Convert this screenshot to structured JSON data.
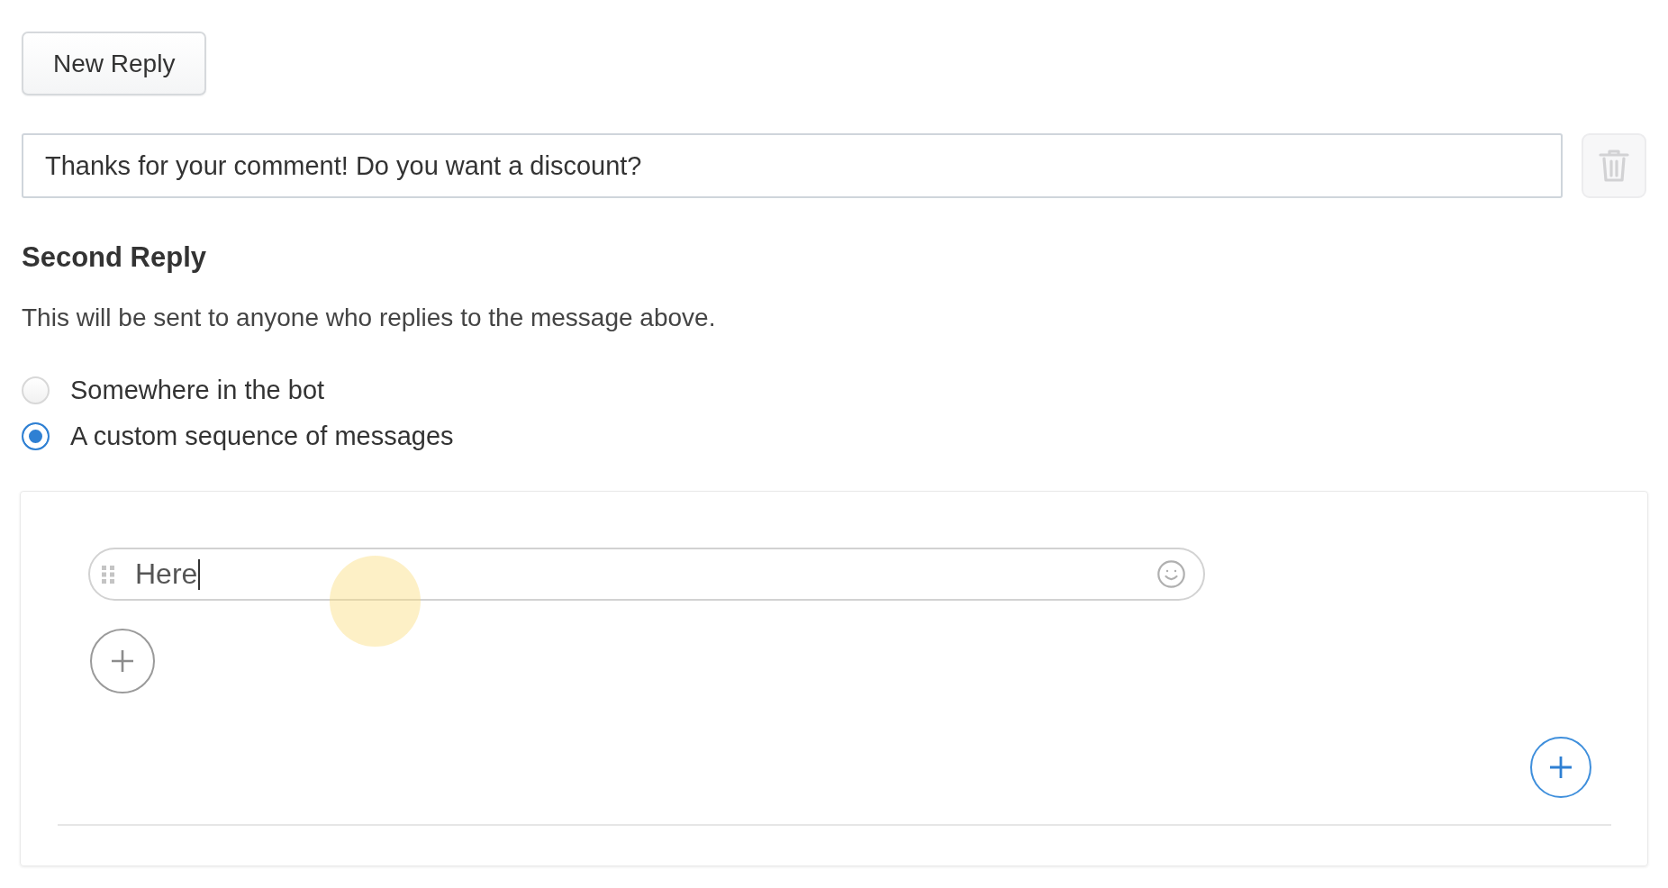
{
  "new_reply_button": {
    "label": "New Reply"
  },
  "first_reply": {
    "value": "Thanks for your comment! Do you want a discount?"
  },
  "delete_button": {
    "disabled": true
  },
  "second_reply": {
    "title": "Second Reply",
    "description": "This will be sent to anyone who replies to the message above.",
    "options": [
      {
        "label": "Somewhere in the bot",
        "selected": false
      },
      {
        "label": "A custom sequence of messages",
        "selected": true
      }
    ],
    "sequence": {
      "messages": [
        {
          "value": "Here",
          "focused": true
        }
      ]
    }
  }
}
